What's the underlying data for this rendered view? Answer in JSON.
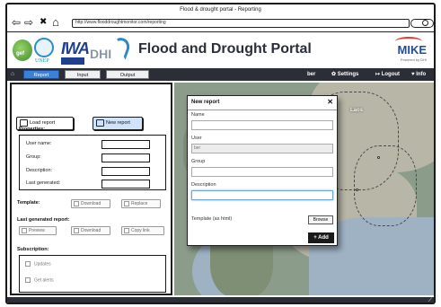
{
  "browser": {
    "window_title": "Flood & drought portal - Reporting",
    "url": "http://www.flooddroughtmonitor.com/reporting",
    "back_glyph": "⇦",
    "forward_glyph": "⇨",
    "stop_glyph": "✖",
    "home_glyph": "⌂"
  },
  "header": {
    "gef_text": "gef",
    "unep_text": "UNEP",
    "iwa_text": "IWA",
    "dhi_text": "DHI",
    "portal_title": "Flood and Drought Portal",
    "mike_text": "MIKE",
    "mike_sub": "Powered by DHI"
  },
  "menubar": {
    "home_glyph": "⌂",
    "tabs": [
      {
        "label": "Report",
        "active": true
      },
      {
        "label": "Input",
        "active": false
      },
      {
        "label": "Output",
        "active": false
      }
    ],
    "user": "ber",
    "settings": "✿ Settings",
    "logout": "↦ Logout",
    "info": "♥ Info"
  },
  "leftpanel": {
    "load_report": "Load report",
    "new_report": "New report",
    "properties_label": "Properties:",
    "props": [
      "User name:",
      "Group:",
      "Description:",
      "Last generated:"
    ],
    "template_label": "Template:",
    "template_buttons": [
      "Download",
      "Replace"
    ],
    "last_generated_label": "Last generated report:",
    "last_generated_buttons": [
      "Preview",
      "Download",
      "Copy link"
    ],
    "subscription_label": "Subscription:",
    "subscriptions": [
      "Updates",
      "Get alerts"
    ]
  },
  "map": {
    "labels": [
      "Laos"
    ]
  },
  "dialog": {
    "title": "New report",
    "close_glyph": "✕",
    "name_label": "Name",
    "name_value": "",
    "user_label": "User",
    "user_value": "ber",
    "group_label": "Group",
    "group_value": "",
    "description_label": "Description",
    "description_value": "",
    "template_label": "Template (as html)",
    "browse": "Browse",
    "add": "+ Add"
  },
  "colors": {
    "active_tab": "#3b82d6",
    "menubar": "#2b2e36",
    "primary_button": "#cfe4fb"
  }
}
